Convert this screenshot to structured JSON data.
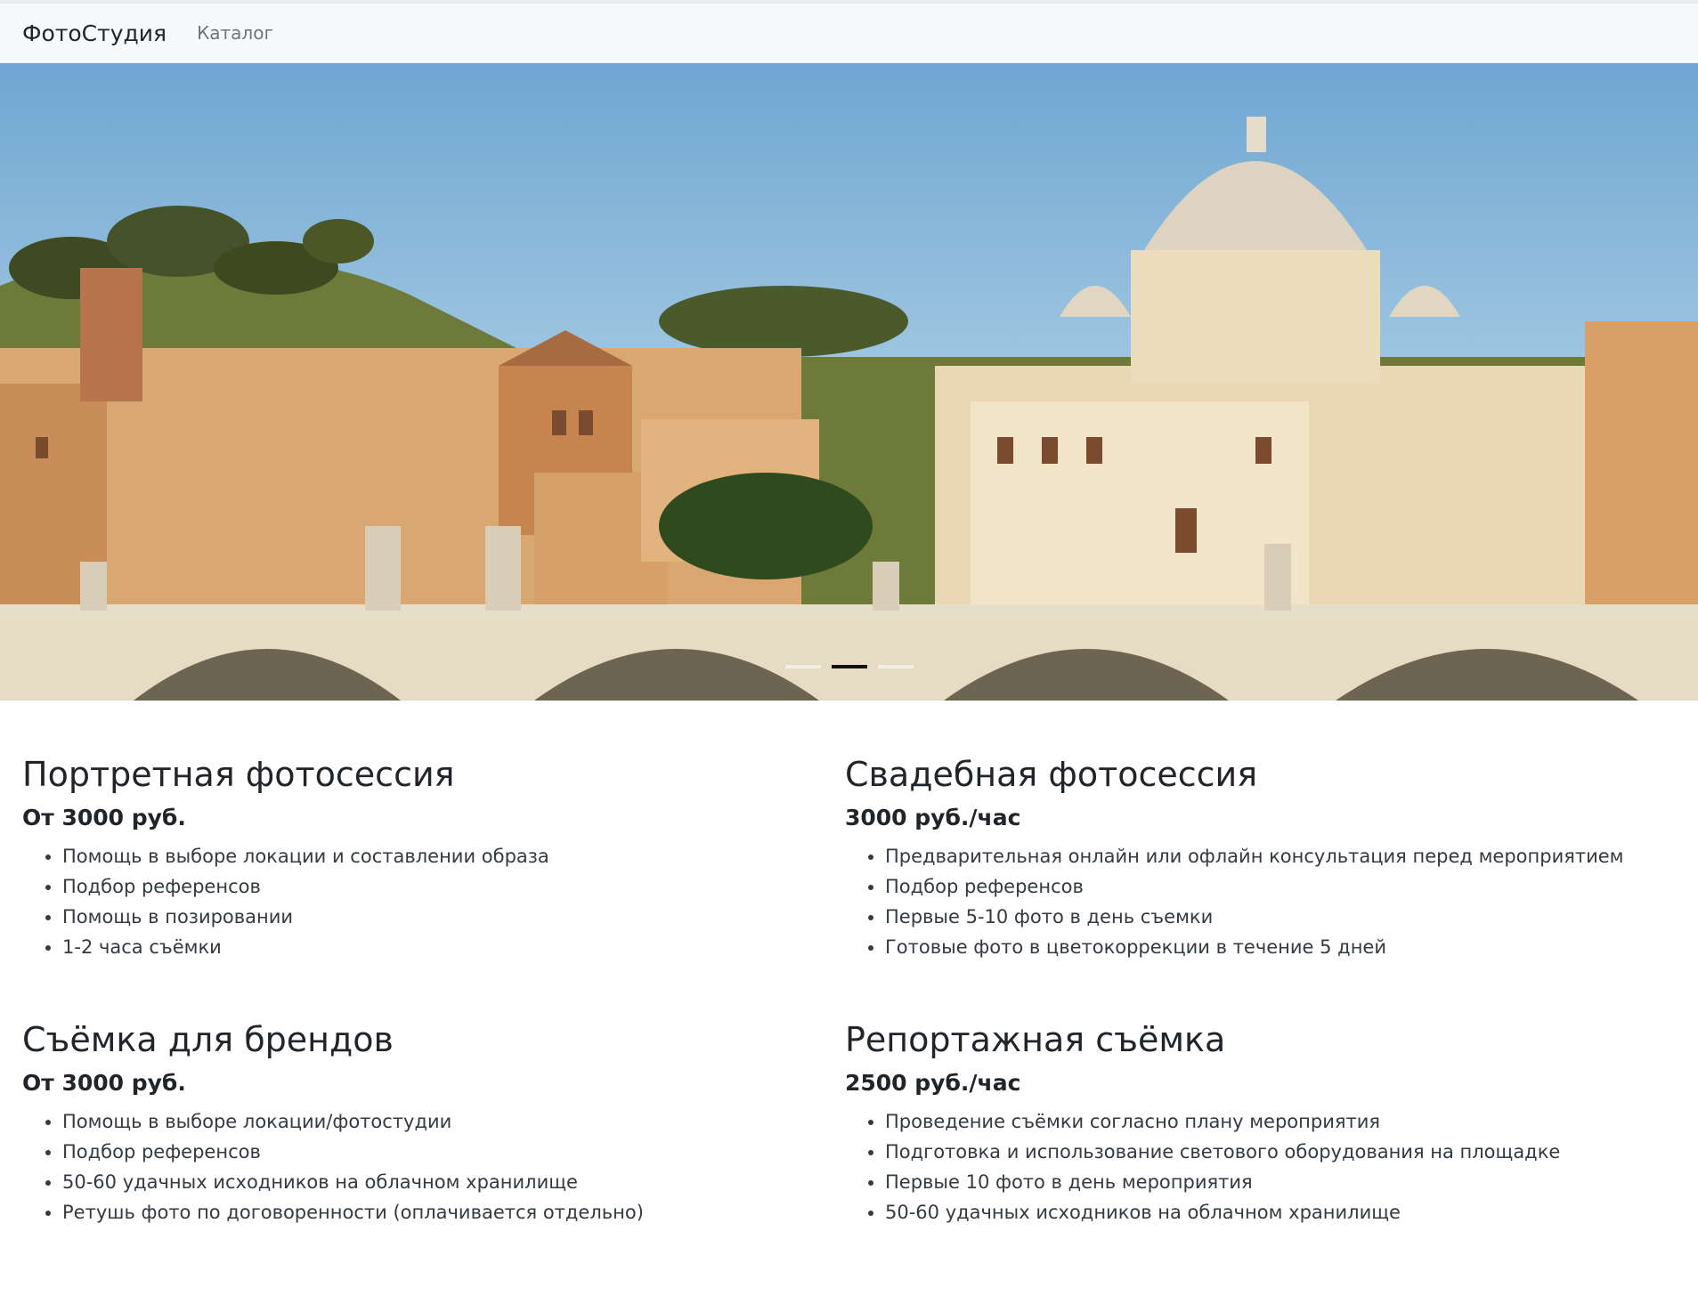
{
  "navbar": {
    "brand": "ФотоСтудия",
    "links": [
      "Каталог"
    ]
  },
  "carousel": {
    "slide_count": 3,
    "active_index": 1
  },
  "services": [
    {
      "title": "Портретная фотосессия",
      "price": "От 3000 руб.",
      "features": [
        "Помощь в выборе локации и составлении образа",
        "Подбор референсов",
        "Помощь в позировании",
        "1-2 часа съёмки"
      ]
    },
    {
      "title": "Свадебная фотосессия",
      "price": "3000 руб./час",
      "features": [
        "Предварительная онлайн или офлайн консультация перед мероприятием",
        "Подбор референсов",
        "Первые 5-10 фото в день съемки",
        "Готовые фото в цветокоррекции в течение 5 дней"
      ]
    },
    {
      "title": "Съёмка для брендов",
      "price": "От 3000 руб.",
      "features": [
        "Помощь в выборе локации/фотостудии",
        "Подбор референсов",
        "50-60 удачных исходников на облачном хранилище",
        "Ретушь фото по договоренности (оплачивается отдельно)"
      ]
    },
    {
      "title": "Репортажная съёмка",
      "price": "2500 руб./час",
      "features": [
        "Проведение съёмки согласно плану мероприятия",
        "Подготовка и использование светового оборудования на площадке",
        "Первые 10 фото в день мероприятия",
        "50-60 удачных исходников на облачном хранилище"
      ]
    }
  ]
}
